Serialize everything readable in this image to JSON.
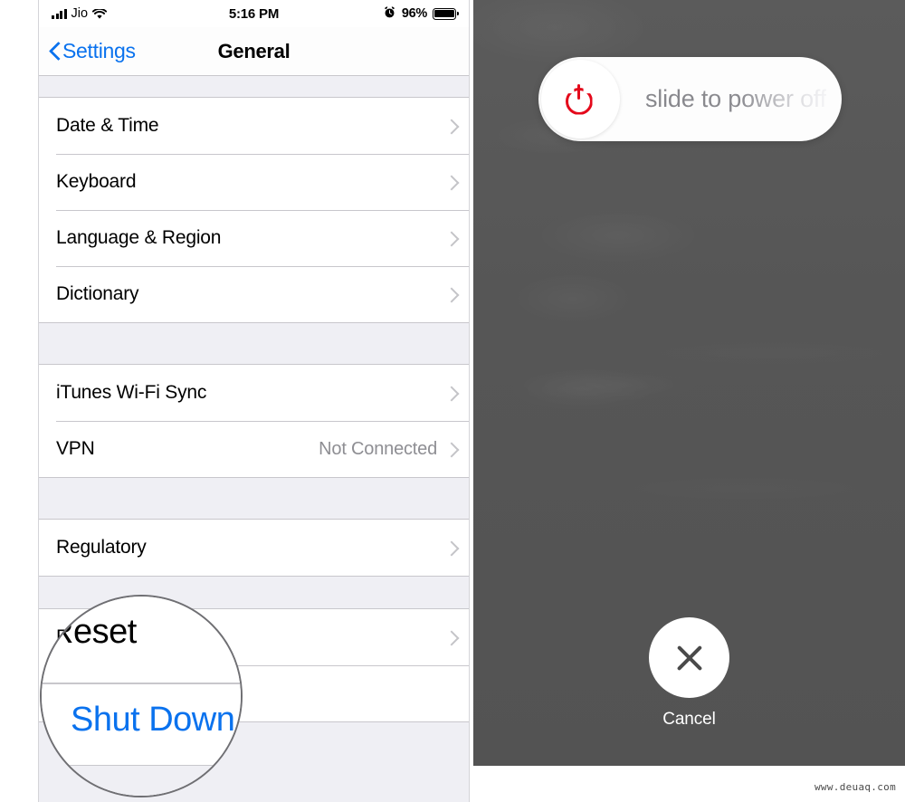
{
  "left_phone": {
    "status_bar": {
      "signal_icon": "signal-bars-icon",
      "carrier": "Jio",
      "wifi_icon": "wifi-icon",
      "time": "5:16 PM",
      "alarm_icon": "alarm-clock-icon",
      "battery_percent": "96%",
      "battery_icon": "battery-full-icon"
    },
    "nav_bar": {
      "back_label": "Settings",
      "back_icon": "chevron-left-icon",
      "title": "General"
    },
    "groups": [
      {
        "rows": [
          {
            "label": "Date & Time",
            "value": "",
            "accessory": "chevron-right-icon",
            "style": "default"
          },
          {
            "label": "Keyboard",
            "value": "",
            "accessory": "chevron-right-icon",
            "style": "default"
          },
          {
            "label": "Language & Region",
            "value": "",
            "accessory": "chevron-right-icon",
            "style": "default"
          },
          {
            "label": "Dictionary",
            "value": "",
            "accessory": "chevron-right-icon",
            "style": "default"
          }
        ]
      },
      {
        "rows": [
          {
            "label": "iTunes Wi-Fi Sync",
            "value": "",
            "accessory": "chevron-right-icon",
            "style": "default"
          },
          {
            "label": "VPN",
            "value": "Not Connected",
            "accessory": "chevron-right-icon",
            "style": "default"
          }
        ]
      },
      {
        "rows": [
          {
            "label": "Regulatory",
            "value": "",
            "accessory": "chevron-right-icon",
            "style": "default"
          }
        ]
      },
      {
        "rows": [
          {
            "label": "Reset",
            "value": "",
            "accessory": "chevron-right-icon",
            "style": "default"
          },
          {
            "label": "Shut Down",
            "value": "",
            "accessory": "",
            "style": "blue"
          }
        ]
      }
    ],
    "magnifier": {
      "reset_label": "Reset",
      "shut_down_label": "Shut Down"
    }
  },
  "right_phone": {
    "slider": {
      "power_icon": "power-icon",
      "text": "slide to power off"
    },
    "cancel": {
      "icon": "close-x-icon",
      "label": "Cancel"
    }
  },
  "watermark": "www.deuaq.com",
  "colors": {
    "ios_blue": "#0a72ee",
    "power_red": "#e4091b",
    "list_bg": "#efeff4",
    "dim_overlay": "#565656",
    "separator": "#c8c7cc",
    "secondary_text": "#8e8e93"
  }
}
